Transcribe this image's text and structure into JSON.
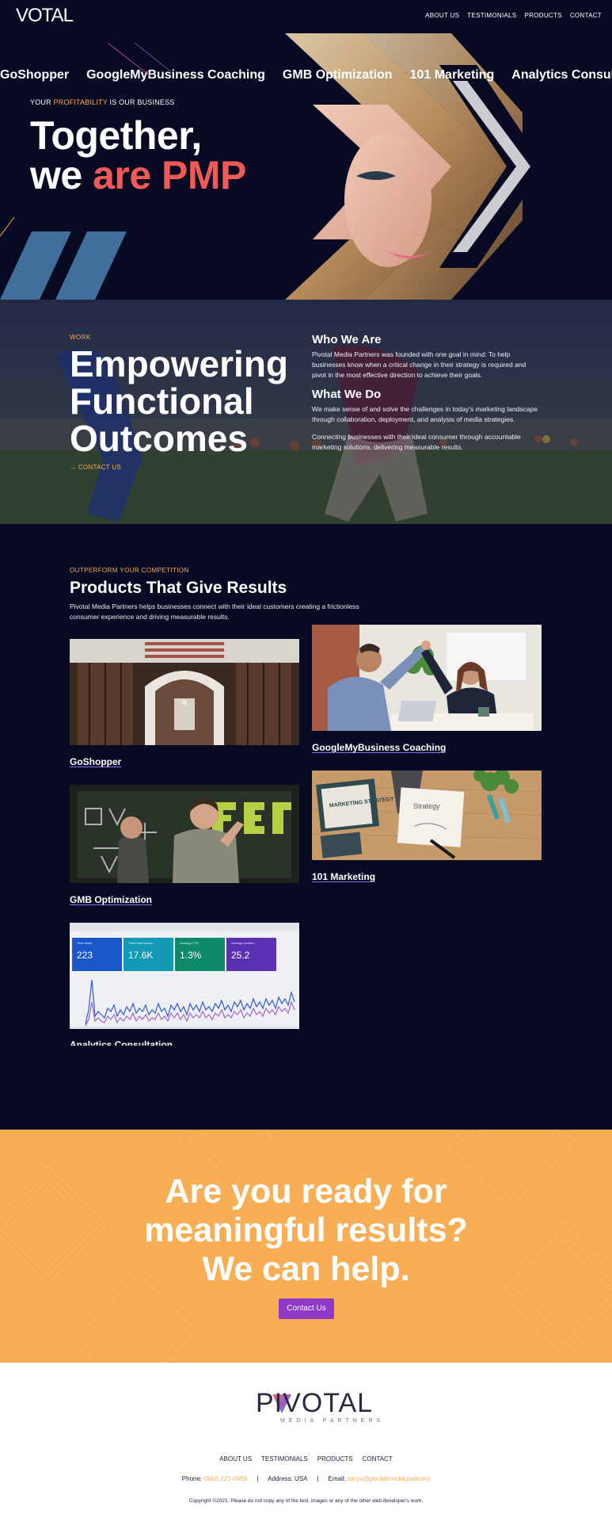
{
  "brand": {
    "logo_text": "VOTAL"
  },
  "nav": [
    "ABOUT US",
    "TESTIMONIALS",
    "PRODUCTS",
    "CONTACT"
  ],
  "marquee": [
    "GoShopper",
    "GoogleMyBusiness Coaching",
    "GMB Optimization",
    "101 Marketing",
    "Analytics Consultation"
  ],
  "hero": {
    "tagline_a": "YOUR ",
    "tagline_hl": "PROFITABILITY",
    "tagline_b": " IS OUR BUSINESS",
    "headline_1": "Together,",
    "headline_2a": "we ",
    "headline_2b": "are PMP"
  },
  "work": {
    "eyebrow": "WORK",
    "title_1": "Empowering",
    "title_2": "Functional",
    "title_3": "Outcomes",
    "link": "→ CONTACT US",
    "who_title": "Who We Are",
    "who_text": "Pivotal Media Partners was founded with one goal in mind: To help businesses know when a critical change in their strategy is required and pivot in the most effective direction to achieve their goals.",
    "what_title": "What We Do",
    "what_text_1": "We make sense of and solve the challenges in today's marketing landscape through collaboration, deployment, and analysis of media strategies.",
    "what_text_2": "Connecting businesses with their ideal consumer through accountable marketing solutions, delivering measurable results."
  },
  "products": {
    "eyebrow": "OUTPERFORM YOUR COMPETITION",
    "title": "Products That Give Results",
    "desc": "Pivotal Media Partners helps businesses connect with their ideal customers creating a frictionless consumer experience and driving measurable results.",
    "items": [
      {
        "label": "GoShopper"
      },
      {
        "label": "GoogleMyBusiness Coaching"
      },
      {
        "label": "GMB Optimization"
      },
      {
        "label": "101 Marketing"
      },
      {
        "label": "Analytics Consultation"
      }
    ],
    "stats": [
      {
        "label": "Total clicks",
        "value": "223",
        "color": "#1b57c9"
      },
      {
        "label": "Total impressions",
        "value": "17.6K",
        "color": "#1398b5"
      },
      {
        "label": "Average CTR",
        "value": "1.3%",
        "color": "#0e8a6a"
      },
      {
        "label": "Average position",
        "value": "25.2",
        "color": "#5a2fb0"
      }
    ],
    "note_card": "Strategy",
    "book_text": "MARKETING STRATEGY"
  },
  "cta": {
    "line_1": "Are you ready for",
    "line_2": "meaningful results?",
    "line_3": "We can help.",
    "button": "Contact Us"
  },
  "footer": {
    "logo_text": "PIVOTAL",
    "logo_sub": "MEDIA PARTNERS",
    "nav": [
      "ABOUT US",
      "TESTIMONIALS",
      "PRODUCTS",
      "CONTACT"
    ],
    "phone_label": "Phone: ",
    "phone": "(980) 221-0959",
    "address": "Address: USA",
    "email_label": "Email: ",
    "email": "tonya@pivotalmedia.partners",
    "copyright": "Copyright ©2021. Please do not copy any of the text, images or any of the other web developer's work."
  },
  "colors": {
    "navy": "#070a22",
    "orange": "#f8ae55",
    "coral": "#ee5b56",
    "purple": "#8f39c6",
    "gold": "#f6ae54"
  }
}
